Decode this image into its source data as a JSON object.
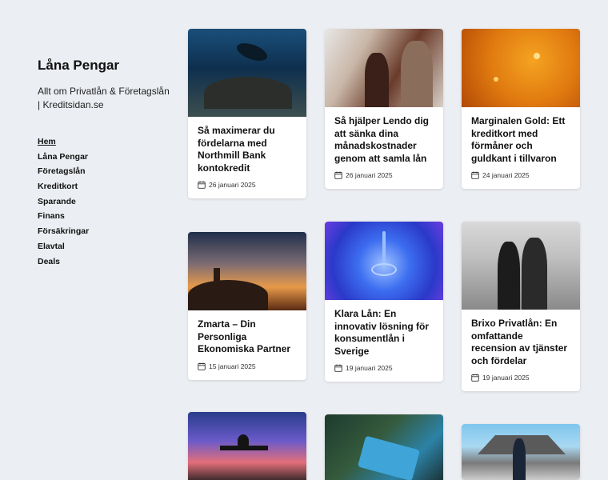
{
  "site": {
    "title": "Låna Pengar",
    "description": "Allt om Privatlån & Företagslån | Kreditsidan.se"
  },
  "nav": [
    {
      "label": "Hem"
    },
    {
      "label": "Låna Pengar"
    },
    {
      "label": "Företagslån"
    },
    {
      "label": "Kreditkort"
    },
    {
      "label": "Sparande"
    },
    {
      "label": "Finans"
    },
    {
      "label": "Försäkringar"
    },
    {
      "label": "Elavtal"
    },
    {
      "label": "Deals"
    }
  ],
  "posts": [
    {
      "title": "Så maximerar du fördelarna med Northmill Bank kontokredit",
      "date": "26 januari 2025",
      "image_icon": "diver-image"
    },
    {
      "title": "Så hjälper Lendo dig att sänka dina månadskostnader genom att samla lån",
      "date": "26 januari 2025",
      "image_icon": "people-image"
    },
    {
      "title": "Marginalen Gold: Ett kreditkort med förmåner och guldkant i tillvaron",
      "date": "24 januari 2025",
      "image_icon": "gold-bubbles-image"
    },
    {
      "title": "Zmarta – Din Personliga Ekonomiska Partner",
      "date": "15 januari 2025",
      "image_icon": "sunset-castle-image"
    },
    {
      "title": "Klara Lån: En innovativ lösning för konsumentlån i Sverige",
      "date": "19 januari 2025",
      "image_icon": "water-drop-image"
    },
    {
      "title": "Brixo Privatlån: En omfattande recension av tjänster och fördelar",
      "date": "19 januari 2025",
      "image_icon": "women-phone-image"
    },
    {
      "title": "",
      "date": "",
      "image_icon": "bench-sunset-image"
    },
    {
      "title": "",
      "date": "",
      "image_icon": "credit-card-hand-image"
    },
    {
      "title": "",
      "date": "",
      "image_icon": "man-building-image"
    }
  ]
}
